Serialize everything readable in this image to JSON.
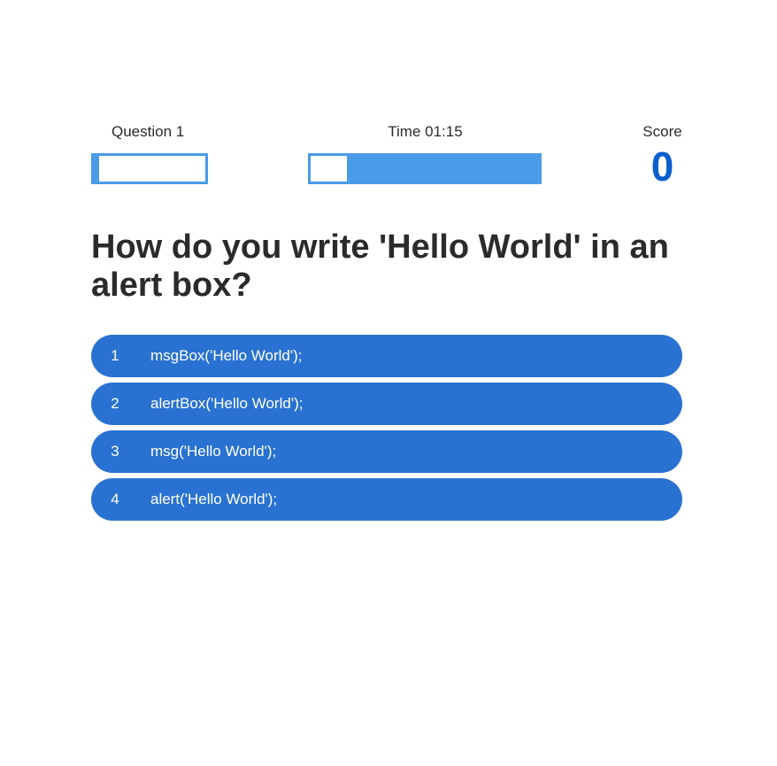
{
  "hud": {
    "question_label": "Question 1",
    "time_label": "Time 01:15",
    "score_label": "Score",
    "score_value": "0",
    "question_progress": 0.05,
    "time_remaining_fraction": 0.84
  },
  "question": {
    "text": "How do you write 'Hello World' in an alert box?"
  },
  "answers": [
    {
      "number": "1",
      "text": "msgBox('Hello World');"
    },
    {
      "number": "2",
      "text": "alertBox('Hello World');"
    },
    {
      "number": "3",
      "text": "msg('Hello World');"
    },
    {
      "number": "4",
      "text": "alert('Hello World');"
    }
  ],
  "colors": {
    "accent": "#2a72d1",
    "bar": "#4a9be8",
    "score": "#0a5fcc"
  }
}
